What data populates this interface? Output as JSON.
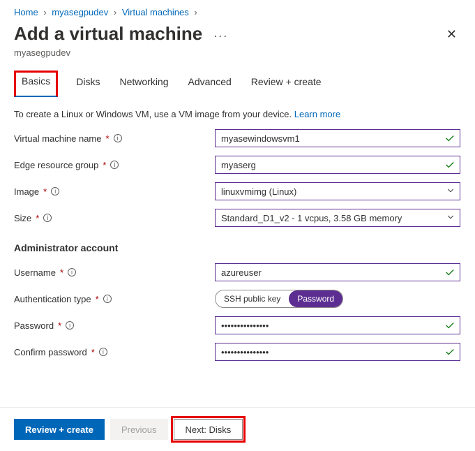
{
  "breadcrumb": {
    "items": [
      "Home",
      "myasegpudev",
      "Virtual machines"
    ],
    "sep": "›"
  },
  "header": {
    "title": "Add a virtual machine",
    "subtitle": "myasegpudev"
  },
  "tabs": {
    "items": [
      "Basics",
      "Disks",
      "Networking",
      "Advanced",
      "Review + create"
    ],
    "active": 0
  },
  "intro": {
    "text": "To create a Linux or Windows VM, use a VM image from your device.",
    "link": "Learn more"
  },
  "fields": {
    "vm_name": {
      "label": "Virtual machine name",
      "value": "myasewindowsvm1"
    },
    "edge_rg": {
      "label": "Edge resource group",
      "value": "myaserg"
    },
    "image": {
      "label": "Image",
      "value": "linuxvmimg (Linux)"
    },
    "size": {
      "label": "Size",
      "value": "Standard_D1_v2 - 1 vcpus, 3.58 GB memory"
    },
    "admin_section": "Administrator account",
    "username": {
      "label": "Username",
      "value": "azureuser"
    },
    "auth_type": {
      "label": "Authentication type",
      "options": [
        "SSH public key",
        "Password"
      ],
      "selected": 1
    },
    "password": {
      "label": "Password",
      "value": "•••••••••••••••"
    },
    "confirm_password": {
      "label": "Confirm password",
      "value": "•••••••••••••••"
    }
  },
  "footer": {
    "review": "Review + create",
    "previous": "Previous",
    "next": "Next: Disks"
  }
}
